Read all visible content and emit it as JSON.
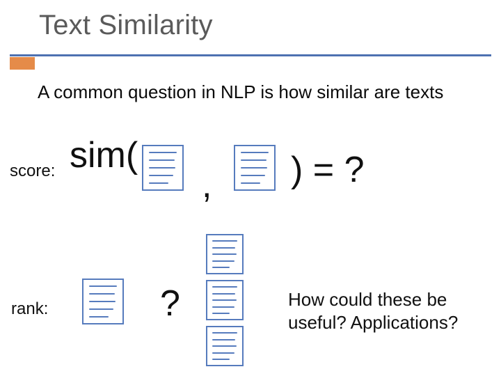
{
  "title": "Text Similarity",
  "intro": "A common question in NLP is how similar are texts",
  "score": {
    "label": "score:",
    "sim_open": "sim(",
    "comma": ",",
    "close_eq": ") = ?"
  },
  "rank": {
    "label": "rank:",
    "question_mark": "?"
  },
  "applications": "How could these be useful?  Applications?",
  "icons": {
    "document": "document-icon"
  }
}
